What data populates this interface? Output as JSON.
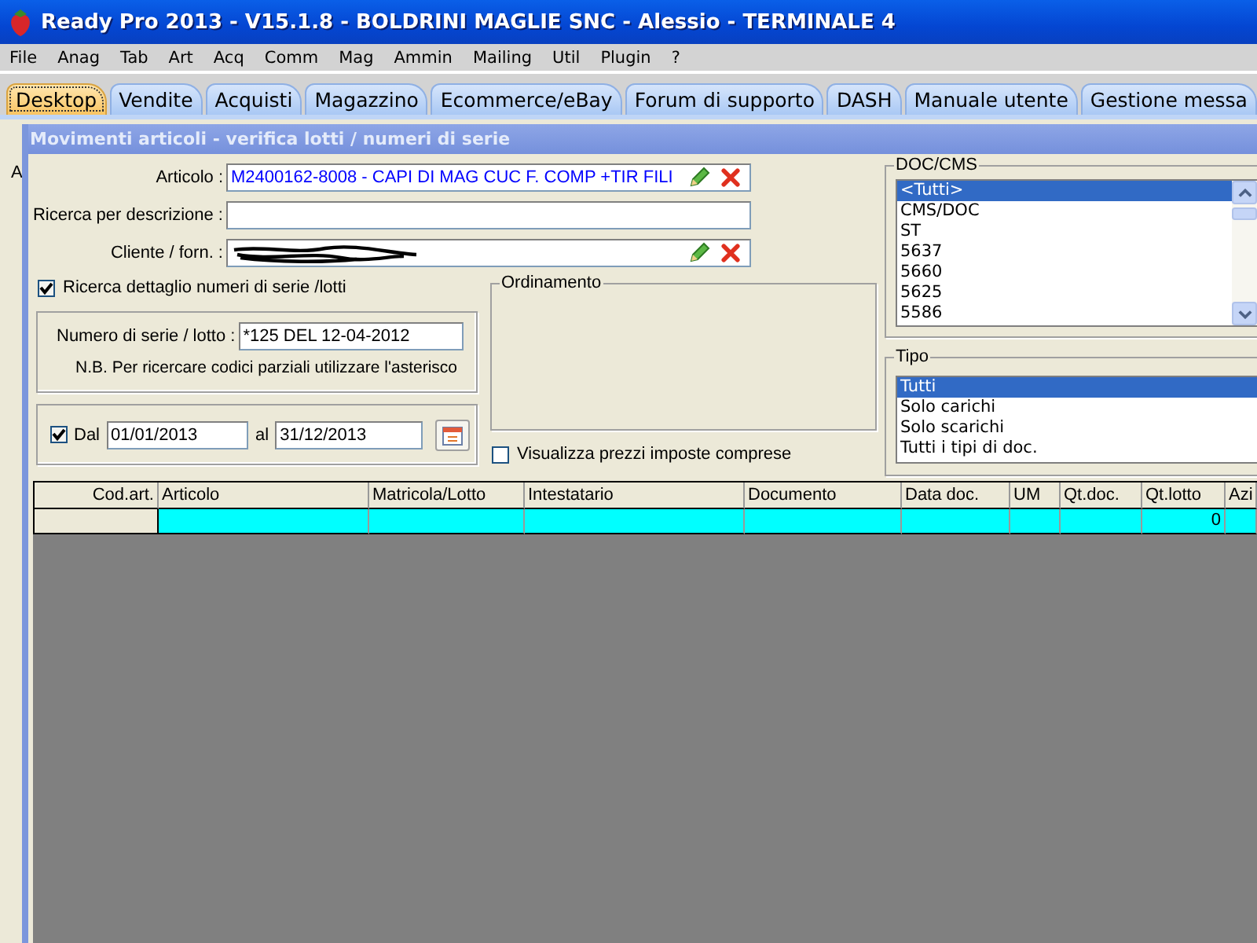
{
  "window": {
    "title": "Ready Pro 2013 - V15.1.8 - BOLDRINI MAGLIE SNC - Alessio - TERMINALE 4"
  },
  "menu": [
    "File",
    "Anag",
    "Tab",
    "Art",
    "Acq",
    "Comm",
    "Mag",
    "Ammin",
    "Mailing",
    "Util",
    "Plugin",
    "?"
  ],
  "tabs": [
    {
      "label": "Desktop",
      "selected": true
    },
    {
      "label": "Vendite",
      "selected": false
    },
    {
      "label": "Acquisti",
      "selected": false
    },
    {
      "label": "Magazzino",
      "selected": false
    },
    {
      "label": "Ecommerce/eBay",
      "selected": false
    },
    {
      "label": "Forum di supporto",
      "selected": false
    },
    {
      "label": "DASH",
      "selected": false
    },
    {
      "label": "Manuale utente",
      "selected": false
    },
    {
      "label": "Gestione messa",
      "selected": false
    }
  ],
  "background_label": "A",
  "dialog": {
    "title": "Movimenti articoli - verifica lotti / numeri di serie",
    "fields": [
      {
        "kind": "lookup",
        "label": "Articolo :",
        "value": "M2400162-8008 - CAPI DI MAG CUC F. COMP +TIR FILI",
        "redacted": false
      },
      {
        "kind": "text",
        "label": "Ricerca per descrizione :",
        "redacted": false
      },
      {
        "kind": "lookup",
        "label": "Cliente / forn. :",
        "redacted": true
      }
    ],
    "serial_search": {
      "label": "Ricerca dettaglio numeri di serie /lotti",
      "checked": true
    },
    "serial_box": {
      "label": "Numero di serie / lotto :",
      "value": "*125 DEL 12-04-2012",
      "note": "N.B. Per ricercare codici parziali utilizzare l'asterisco"
    },
    "date_range": {
      "checked": true,
      "from_label": "Dal",
      "from": "01/01/2013",
      "to_label": "al",
      "to": "31/12/2013"
    },
    "sorting": {
      "title": "Ordinamento"
    },
    "include_taxes": {
      "label": "Visualizza prezzi imposte comprese",
      "checked": false
    },
    "doc_cms": {
      "title": "DOC/CMS",
      "items": [
        {
          "label": "<Tutti>",
          "selected": true
        },
        {
          "label": "CMS/DOC",
          "selected": false
        },
        {
          "label": "ST",
          "selected": false
        },
        {
          "label": "5637",
          "selected": false
        },
        {
          "label": "5660",
          "selected": false
        },
        {
          "label": "5625",
          "selected": false
        },
        {
          "label": "5586",
          "selected": false
        }
      ]
    },
    "tipo": {
      "title": "Tipo",
      "items": [
        {
          "label": "Tutti",
          "selected": true
        },
        {
          "label": "Solo carichi",
          "selected": false
        },
        {
          "label": "Solo scarichi",
          "selected": false
        },
        {
          "label": "Tutti i tipi di doc.",
          "selected": false
        }
      ]
    },
    "table": {
      "columns": [
        "Cod.art.",
        "Articolo",
        "Matricola/Lotto",
        "Intestatario",
        "Documento",
        "Data doc.",
        "UM",
        "Qt.doc.",
        "Qt.lotto",
        "Azi"
      ],
      "rows": [
        {
          "selected": true,
          "cells": [
            null,
            null,
            null,
            null,
            null,
            null,
            null,
            null,
            "0",
            null
          ]
        }
      ]
    }
  }
}
